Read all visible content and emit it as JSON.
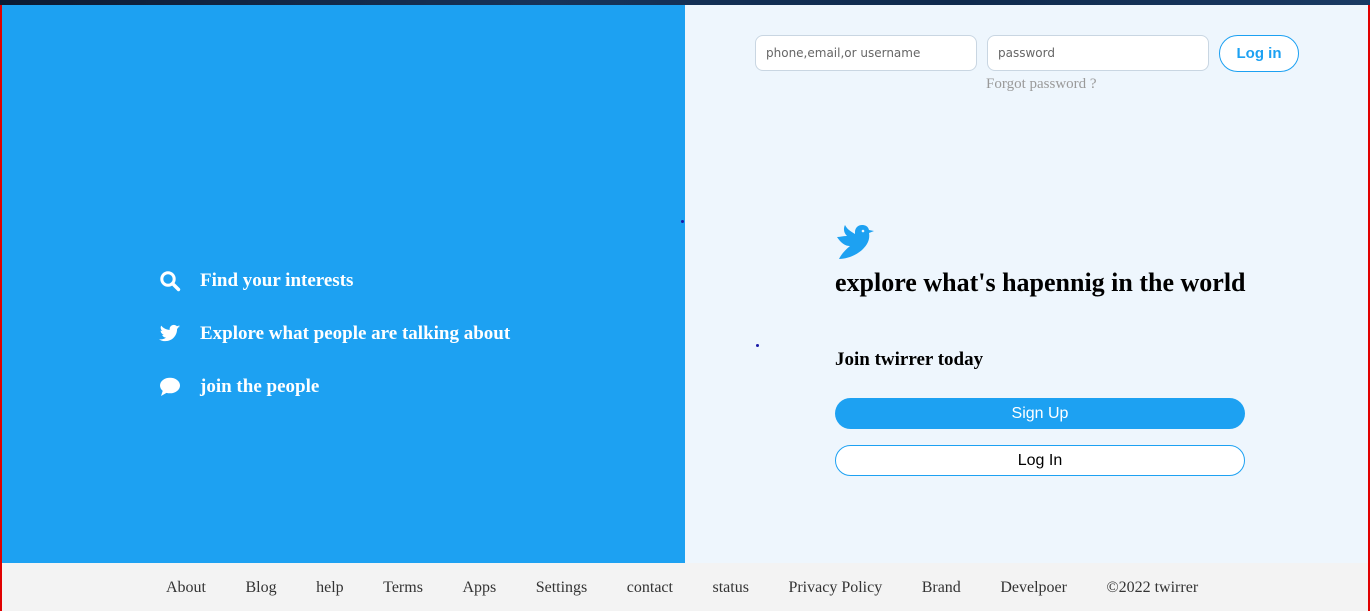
{
  "left_panel": {
    "background": "#1da1f2",
    "features": [
      {
        "icon": "search-icon",
        "label": "Find your interests"
      },
      {
        "icon": "bird-icon",
        "label": "Explore what people are talking about"
      },
      {
        "icon": "chat-bubble-icon",
        "label": "join the people"
      }
    ]
  },
  "login_form": {
    "username_placeholder": "phone,email,or username",
    "username_value": "",
    "password_placeholder": "password",
    "password_value": "",
    "login_label": "Log in",
    "forgot_label": "Forgot password ?"
  },
  "main": {
    "logo_icon": "bird-logo-icon",
    "headline": "explore what's hapennig in the world",
    "subheadline": "Join twirrer today",
    "signup_label": "Sign Up",
    "login_label": "Log In"
  },
  "footer": {
    "links": [
      "About",
      "Blog",
      "help",
      "Terms",
      "Apps",
      "Settings",
      "contact",
      "status",
      "Privacy Policy",
      "Brand",
      "Develpoer"
    ],
    "copyright": "©2022 twirrer"
  },
  "colors": {
    "accent": "#1da1f2",
    "right_bg": "#eef6fd",
    "footer_bg": "#f3f3f3",
    "frame_border": "#e00000"
  }
}
